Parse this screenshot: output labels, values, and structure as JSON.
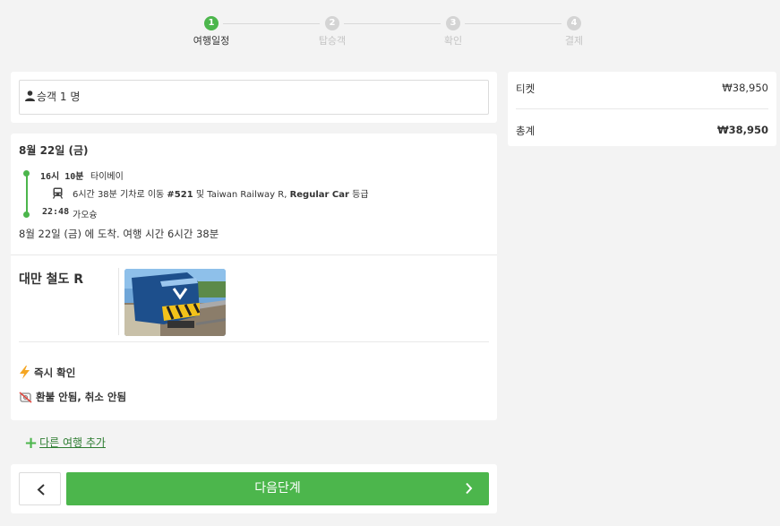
{
  "stepper": {
    "steps": [
      {
        "num": "1",
        "label": "여행일정",
        "active": true
      },
      {
        "num": "2",
        "label": "탑승객",
        "active": false
      },
      {
        "num": "3",
        "label": "확인",
        "active": false
      },
      {
        "num": "4",
        "label": "결제",
        "active": false
      }
    ]
  },
  "passenger": {
    "label": "승객 1 명"
  },
  "itinerary": {
    "date": "8월 22일 (금)",
    "departure": {
      "time": "16시 10분",
      "station": "타이베이"
    },
    "trip": {
      "prefix": "6시간 38분 기차로 이동",
      "train_no": "#521",
      "mid": "및 Taiwan Railway R,",
      "class": "Regular Car",
      "suffix": "등급"
    },
    "arrival_stop": {
      "time": "22:48",
      "station": "가오슝"
    },
    "arrival_note": "8월 22일 (금) 에 도착. 여행 시간 6시간 38분"
  },
  "operator": {
    "name": "대만 철도 R"
  },
  "features": [
    {
      "icon": "lightning-icon",
      "label": "즉시 확인"
    },
    {
      "icon": "no-refund-icon",
      "label": "환불 안됨, 취소 안됨"
    }
  ],
  "add_trip": {
    "label": "다른 여행 추가"
  },
  "nav": {
    "next_label": "다음단계"
  },
  "summary": {
    "ticket_label": "티켓",
    "ticket_price": "₩38,950",
    "total_label": "총계",
    "total_price": "₩38,950"
  },
  "colors": {
    "accent": "#4cb64c",
    "link": "#2e7d32",
    "background": "#f3f3f3"
  }
}
